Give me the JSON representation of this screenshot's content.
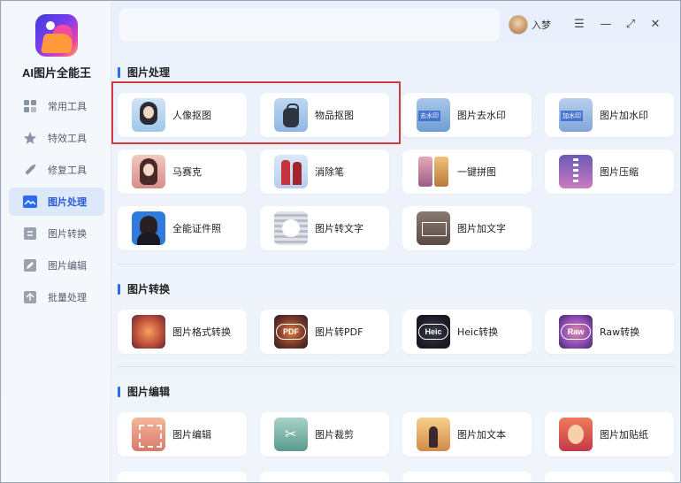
{
  "app": {
    "name": "AI图片全能王"
  },
  "user": {
    "name": "入梦"
  },
  "window": {
    "menu": "☰",
    "minimize": "—",
    "maximize": "⤢",
    "close": "✕"
  },
  "sidebar": {
    "items": [
      {
        "label": "常用工具",
        "icon": "grid-icon"
      },
      {
        "label": "特效工具",
        "icon": "star-icon"
      },
      {
        "label": "修复工具",
        "icon": "magic-wand-icon"
      },
      {
        "label": "图片处理",
        "icon": "image-icon",
        "active": true
      },
      {
        "label": "图片转换",
        "icon": "convert-icon"
      },
      {
        "label": "图片编辑",
        "icon": "edit-icon"
      },
      {
        "label": "批量处理",
        "icon": "batch-icon"
      }
    ]
  },
  "sections": [
    {
      "title": "图片处理",
      "cards": [
        "人像抠图",
        "物品抠图",
        "图片去水印",
        "图片加水印",
        "马赛克",
        "消除笔",
        "一键拼图",
        "图片压缩",
        "全能证件照",
        "图片转文字",
        "图片加文字"
      ]
    },
    {
      "title": "图片转换",
      "cards": [
        "图片格式转换",
        "图片转PDF",
        "Heic转换",
        "Raw转换"
      ],
      "badges": [
        "",
        "PDF",
        "Heic",
        "Raw"
      ]
    },
    {
      "title": "图片编辑",
      "cards": [
        "图片编辑",
        "图片裁剪",
        "图片加文本",
        "图片加贴纸"
      ]
    }
  ],
  "colors": {
    "accent": "#2a6cf0",
    "highlight": "#d43a3a",
    "active_bg": "#dde8fb"
  }
}
